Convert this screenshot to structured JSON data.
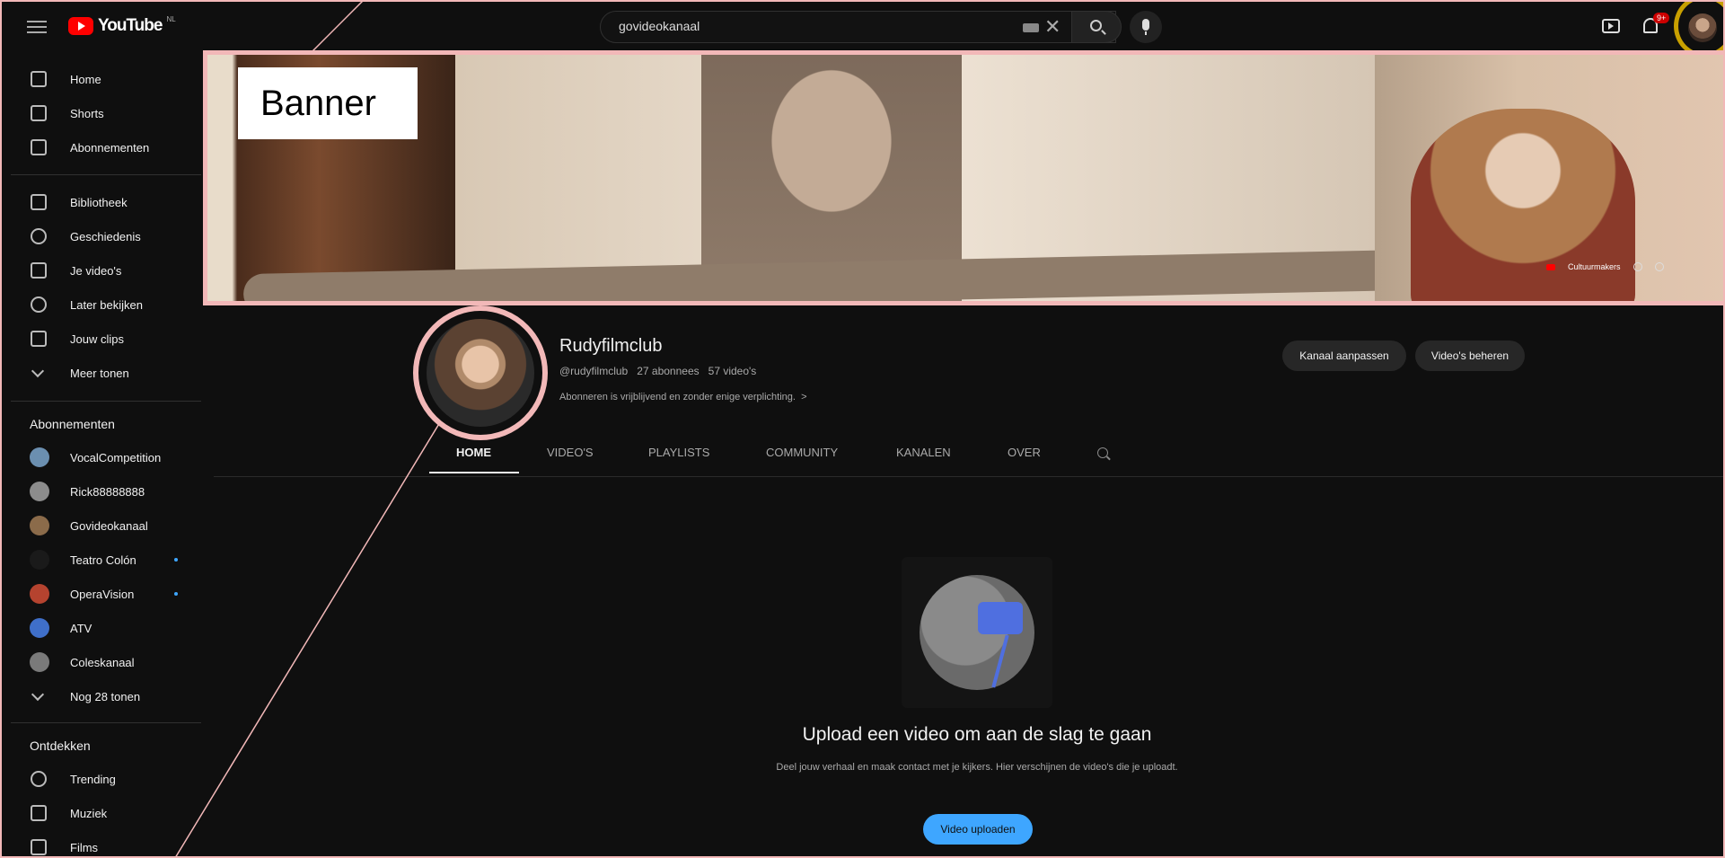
{
  "header": {
    "logo_text": "YouTube",
    "logo_sup": "NL",
    "search_value": "govideokanaal",
    "clear_symbol": "✕",
    "notification_count": "9+"
  },
  "sidebar": {
    "main": [
      {
        "label": "Home",
        "icon": "home-icon"
      },
      {
        "label": "Shorts",
        "icon": "shorts-icon"
      },
      {
        "label": "Abonnementen",
        "icon": "subscriptions-icon"
      }
    ],
    "library": [
      {
        "label": "Bibliotheek",
        "icon": "library-icon"
      },
      {
        "label": "Geschiedenis",
        "icon": "history-icon"
      },
      {
        "label": "Je video's",
        "icon": "your-videos-icon"
      },
      {
        "label": "Later bekijken",
        "icon": "watch-later-icon"
      },
      {
        "label": "Jouw clips",
        "icon": "clips-icon"
      },
      {
        "label": "Meer tonen",
        "icon": "chevron-down-icon"
      }
    ],
    "subscriptions_heading": "Abonnementen",
    "subscriptions": [
      {
        "label": "VocalCompetition",
        "color": "#6b8fb0"
      },
      {
        "label": "Rick88888888",
        "color": "#8c8c8c"
      },
      {
        "label": "Govideokanaal",
        "color": "#8b6b4a"
      },
      {
        "label": "Teatro Colón",
        "color": "#1a1a1a",
        "dot": true
      },
      {
        "label": "OperaVision",
        "color": "#b5432f",
        "dot": true
      },
      {
        "label": "ATV",
        "color": "#3f6fc9"
      },
      {
        "label": "Coleskanaal",
        "color": "#7a7a7a"
      },
      {
        "label": "Nog 28 tonen",
        "icon": "chevron-down-icon"
      }
    ],
    "explore_heading": "Ontdekken",
    "explore": [
      {
        "label": "Trending",
        "icon": "trending-icon"
      },
      {
        "label": "Muziek",
        "icon": "music-icon"
      },
      {
        "label": "Films",
        "icon": "films-icon"
      }
    ]
  },
  "banner": {
    "annotation_label": "Banner",
    "link_text": "Cultuurmakers"
  },
  "channel": {
    "name": "Rudyfilmclub",
    "handle": "@rudyfilmclub",
    "subscribers": "27 abonnees",
    "videos": "57 video's",
    "description": "Abonneren is vrijblijvend en zonder enige verplichting.",
    "customize_button": "Kanaal aanpassen",
    "manage_button": "Video's beheren"
  },
  "tabs": [
    "HOME",
    "VIDEO'S",
    "PLAYLISTS",
    "COMMUNITY",
    "KANALEN",
    "OVER"
  ],
  "active_tab": "HOME",
  "empty_state": {
    "title": "Upload een video om aan de slag te gaan",
    "description": "Deel jouw verhaal en maak contact met je kijkers. Hier verschijnen de video's die je uploadt.",
    "button": "Video uploaden"
  },
  "colors": {
    "accent_blue": "#3ea6ff",
    "brand_red": "#ff0000",
    "annotation_pink": "#f2b8b8",
    "annotation_gold": "#c8a000"
  }
}
